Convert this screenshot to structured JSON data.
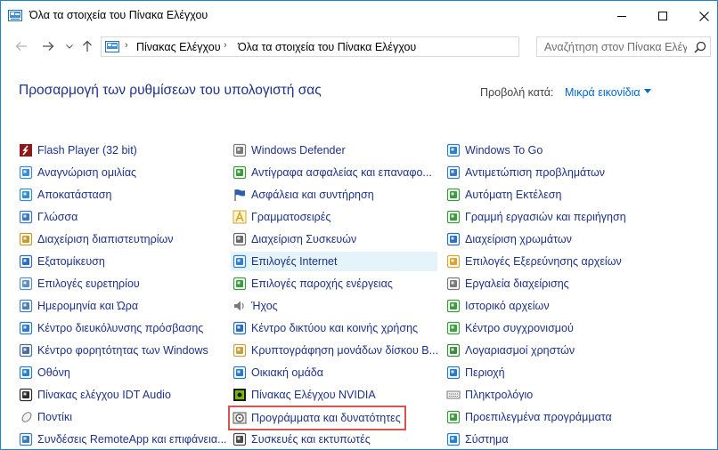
{
  "window": {
    "title": "Όλα τα στοιχεία του Πίνακα Ελέγχου",
    "accent": "#1883d7"
  },
  "nav": {
    "breadcrumbs": [
      "Πίνακας Ελέγχου",
      "Όλα τα στοιχεία του Πίνακα Ελέγχου"
    ],
    "search_placeholder": "Αναζήτηση στον Πίνακα Ελέγ..."
  },
  "header": {
    "title": "Προσαρμογή των ρυθμίσεων του υπολογιστή σας",
    "view_by_label": "Προβολή κατά:",
    "view_by_value": "Μικρά εικονίδια"
  },
  "items": {
    "col1": [
      {
        "label": "Flash Player (32 bit)",
        "icon": "flash-icon",
        "color": "#8b1a1a"
      },
      {
        "label": "Αναγνώριση ομιλίας",
        "icon": "microphone-icon",
        "color": "#3c8dd8"
      },
      {
        "label": "Αποκατάσταση",
        "icon": "recovery-icon",
        "color": "#2f8fd0"
      },
      {
        "label": "Γλώσσα",
        "icon": "language-icon",
        "color": "#3a78c8"
      },
      {
        "label": "Διαχείριση διαπιστευτηρίων",
        "icon": "credential-icon",
        "color": "#c89a2c"
      },
      {
        "label": "Εξατομίκευση",
        "icon": "personalization-icon",
        "color": "#2a6fc4"
      },
      {
        "label": "Επιλογές ευρετηρίου",
        "icon": "indexing-icon",
        "color": "#5a8fc2"
      },
      {
        "label": "Ημερομηνία και Ώρα",
        "icon": "clock-icon",
        "color": "#4a7fb8"
      },
      {
        "label": "Κέντρο διευκόλυνσης πρόσβασης",
        "icon": "accessibility-icon",
        "color": "#2c7ad0"
      },
      {
        "label": "Κέντρο φορητότητας των Windows",
        "icon": "mobility-icon",
        "color": "#4a6f9a"
      },
      {
        "label": "Οθόνη",
        "icon": "display-icon",
        "color": "#2a80cc"
      },
      {
        "label": "Πίνακας ελέγχου IDT Audio",
        "icon": "audio-panel-icon",
        "color": "#2d2d2d"
      },
      {
        "label": "Ποντίκι",
        "icon": "mouse-icon",
        "color": "#777777"
      },
      {
        "label": "Συνδέσεις RemoteApp και επιφάνεια...",
        "icon": "remoteapp-icon",
        "color": "#3a7ac0"
      }
    ],
    "col2": [
      {
        "label": "Windows Defender",
        "icon": "defender-icon",
        "color": "#7a7a7a"
      },
      {
        "label": "Αντίγραφα ασφαλείας και επαναφο...",
        "icon": "backup-icon",
        "color": "#3d9a3d"
      },
      {
        "label": "Ασφάλεια και συντήρηση",
        "icon": "flag-icon",
        "color": "#2a5fb0"
      },
      {
        "label": "Γραμματοσειρές",
        "icon": "fonts-icon",
        "color": "#d4a72c"
      },
      {
        "label": "Διαχείριση Συσκευών",
        "icon": "device-manager-icon",
        "color": "#6a6a6a"
      },
      {
        "label": "Επιλογές Internet",
        "icon": "internet-options-icon",
        "color": "#2d7fcf"
      },
      {
        "label": "Επιλογές παροχής ενέργειας",
        "icon": "power-icon",
        "color": "#3e9a3e"
      },
      {
        "label": "Ήχος",
        "icon": "speaker-icon",
        "color": "#7a7a7a"
      },
      {
        "label": "Κέντρο δικτύου και κοινής χρήσης",
        "icon": "network-icon",
        "color": "#2c6cc0"
      },
      {
        "label": "Κρυπτογράφηση μονάδων δίσκου Β...",
        "icon": "bitlocker-icon",
        "color": "#c8a040"
      },
      {
        "label": "Οικιακή ομάδα",
        "icon": "homegroup-icon",
        "color": "#2a7ac8"
      },
      {
        "label": "Πίνακας Ελέγχου NVIDIA",
        "icon": "nvidia-icon",
        "color": "#76b900"
      },
      {
        "label": "Προγράμματα και δυνατότητες",
        "icon": "programs-icon",
        "color": "#5a5a5a"
      },
      {
        "label": "Συσκευές και εκτυπωτές",
        "icon": "printer-icon",
        "color": "#4a4a4a"
      }
    ],
    "col3": [
      {
        "label": "Windows To Go",
        "icon": "windows-to-go-icon",
        "color": "#2a80d0"
      },
      {
        "label": "Αντιμετώπιση προβλημάτων",
        "icon": "troubleshoot-icon",
        "color": "#3a7ac0"
      },
      {
        "label": "Αυτόματη Εκτέλεση",
        "icon": "autoplay-icon",
        "color": "#3e9a3e"
      },
      {
        "label": "Γραμμή εργασιών και περιήγηση",
        "icon": "taskbar-icon",
        "color": "#3e9a3e"
      },
      {
        "label": "Διαχείριση χρωμάτων",
        "icon": "color-management-icon",
        "color": "#2d6fc8"
      },
      {
        "label": "Επιλογές Εξερεύνησης αρχείων",
        "icon": "folder-options-icon",
        "color": "#d9a530"
      },
      {
        "label": "Εργαλεία διαχείρισης",
        "icon": "admin-tools-icon",
        "color": "#7a7a7a"
      },
      {
        "label": "Ιστορικό αρχείων",
        "icon": "file-history-icon",
        "color": "#3e9a3e"
      },
      {
        "label": "Κέντρο συγχρονισμού",
        "icon": "sync-icon",
        "color": "#3ea03e"
      },
      {
        "label": "Λογαριασμοί χρηστών",
        "icon": "users-icon",
        "color": "#3e8a3e"
      },
      {
        "label": "Περιοχή",
        "icon": "region-icon",
        "color": "#2c7ad0"
      },
      {
        "label": "Πληκτρολόγιο",
        "icon": "keyboard-icon",
        "color": "#7a7a7a"
      },
      {
        "label": "Προεπιλεγμένα προγράμματα",
        "icon": "default-programs-icon",
        "color": "#3e9a3e"
      },
      {
        "label": "Σύστημα",
        "icon": "system-icon",
        "color": "#2a80d0"
      }
    ]
  },
  "highlight_color": "#d9534f",
  "hover_color": "#e5f3fb"
}
